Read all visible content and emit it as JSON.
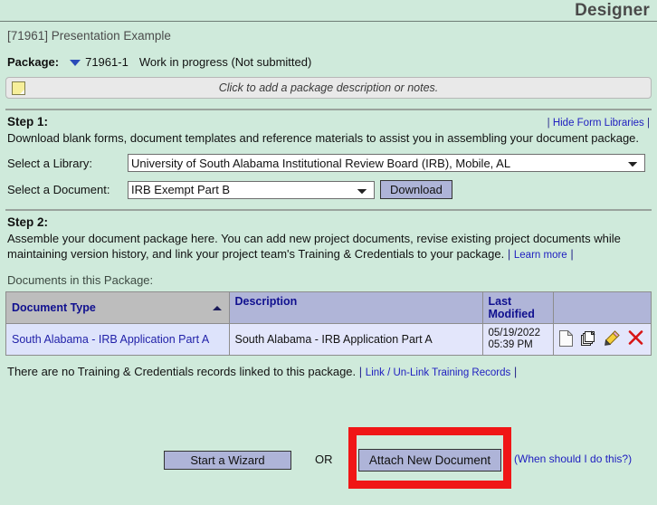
{
  "header": {
    "app_title": "Designer",
    "project_title": "[71961] Presentation Example"
  },
  "package": {
    "label": "Package:",
    "caret_icon": "chevron-down-icon",
    "id": "71961-1",
    "status": "Work in progress (Not submitted)",
    "notes_icon": "note-icon",
    "notes_placeholder": "Click to add a package description or notes."
  },
  "step1": {
    "label": "Step 1:",
    "toggle_link": "Hide Form Libraries",
    "separator": "|",
    "description": "Download blank forms, document templates and reference materials to assist you in assembling your document package.",
    "library_label": "Select a Library:",
    "library_value": "University of South Alabama Institutional Review Board (IRB), Mobile, AL",
    "document_label": "Select a Document:",
    "document_value": "IRB Exempt Part B",
    "download_label": "Download"
  },
  "step2": {
    "label": "Step 2:",
    "description_line1": "Assemble your document package here. You can add new project documents, revise existing project documents while",
    "description_line2": "maintaining version history, and link your project team's Training & Credentials to your package.",
    "learn_more": "Learn more",
    "separator": "|",
    "documents_label": "Documents in this Package:"
  },
  "documents_table": {
    "columns": [
      "Document Type",
      "Description",
      "Last Modified",
      ""
    ],
    "sorted_column": "Document Type",
    "sort_direction": "asc",
    "rows": [
      {
        "document_type": "South Alabama - IRB Application Part A",
        "description": "South Alabama - IRB Application Part A",
        "last_modified_date": "05/19/2022",
        "last_modified_time": "05:39 PM",
        "actions": [
          "document-icon",
          "copy-icon",
          "edit-pencil-icon",
          "delete-x-icon"
        ]
      }
    ]
  },
  "training": {
    "message": "There are no Training & Credentials records linked to this package.",
    "link": "Link / Un-Link Training Records",
    "separator": "|"
  },
  "actions": {
    "start_wizard_label": "Start a Wizard",
    "or_label": "OR",
    "attach_label": "Attach New Document",
    "when_link": "(When should I do this?)"
  },
  "colors": {
    "page_background": "#cfeadb",
    "button_face": "#aeb4d8",
    "table_header": "#b0b5d8",
    "table_header_sorted": "#bdbdbd",
    "row_background": "#e3e6fb",
    "link": "#2020c0",
    "highlight_box": "#f01616"
  }
}
